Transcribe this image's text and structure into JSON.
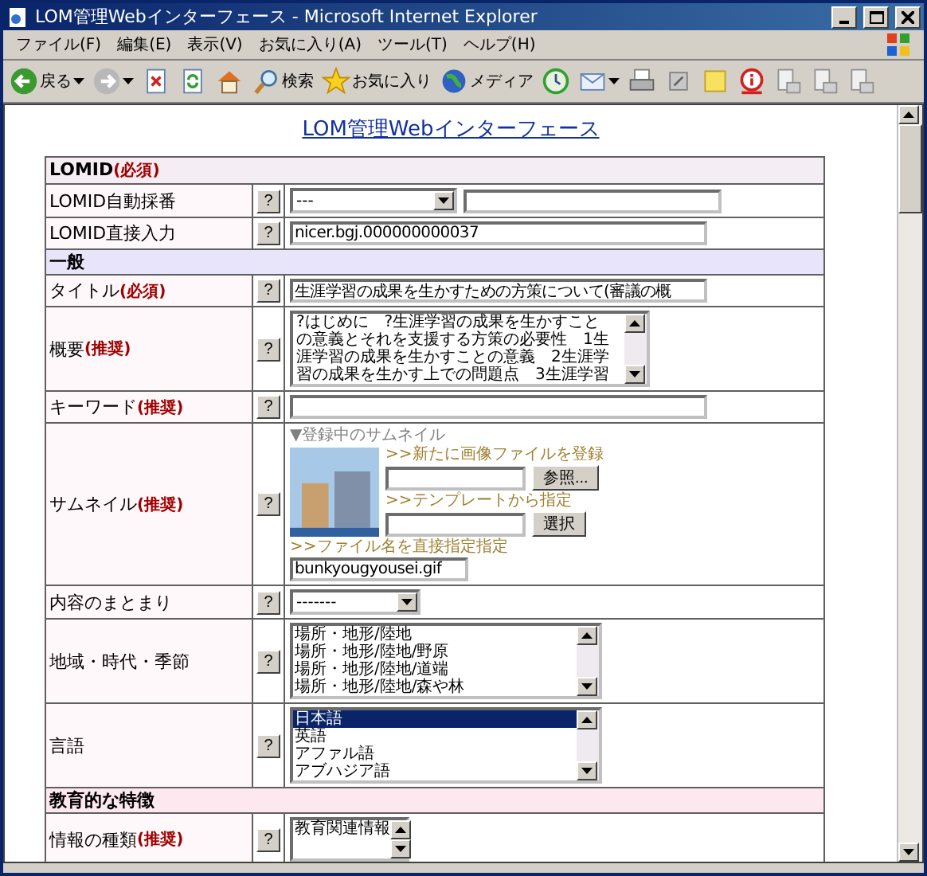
{
  "window": {
    "title": "LOM管理Webインターフェース - Microsoft Internet Explorer"
  },
  "menu": [
    "ファイル(F)",
    "編集(E)",
    "表示(V)",
    "お気に入り(A)",
    "ツール(T)",
    "ヘルプ(H)"
  ],
  "toolbar": [
    {
      "kind": "back",
      "label": "戻る"
    },
    {
      "kind": "forward"
    },
    {
      "kind": "stop"
    },
    {
      "kind": "refresh"
    },
    {
      "kind": "home"
    },
    {
      "kind": "search",
      "label": "検索"
    },
    {
      "kind": "favorites",
      "label": "お気に入り"
    },
    {
      "kind": "media",
      "label": "メディア"
    },
    {
      "kind": "history"
    },
    {
      "kind": "mail"
    },
    {
      "kind": "print"
    },
    {
      "kind": "edit"
    },
    {
      "kind": "note"
    },
    {
      "kind": "info"
    },
    {
      "kind": "doc"
    },
    {
      "kind": "doc"
    },
    {
      "kind": "doc"
    }
  ],
  "page_title": "LOM管理Webインターフェース",
  "form": [
    {
      "kind": "section",
      "label": "LOMID",
      "tag": "(必須)",
      "color": "#f4eef4"
    },
    {
      "kind": "select_text",
      "label": "LOMID自動採番",
      "help": "?",
      "value": "---"
    },
    {
      "kind": "text",
      "label": "LOMID直接入力",
      "help": "?",
      "value": "nicer.bgj.000000000037"
    },
    {
      "kind": "section",
      "label": "一般",
      "color": "#e8e4fa"
    },
    {
      "kind": "text",
      "label": "タイトル",
      "tag": "(必須)",
      "help": "?",
      "value": "生涯学習の成果を生かすための方策について(審議の概"
    },
    {
      "kind": "textarea",
      "label": "概要",
      "tag": "(推奨)",
      "help": "?",
      "lines": [
        "?はじめに　?生涯学習の成果を生かすこと",
        "の意義とそれを支援する方策の必要性　1生",
        "涯学習の成果を生かすことの意義　2生涯学",
        "習の成果を生かす上での問題点　3生涯学習"
      ]
    },
    {
      "kind": "text",
      "label": "キーワード",
      "tag": "(推奨)",
      "help": "?"
    },
    {
      "kind": "thumbnail",
      "label": "サムネイル",
      "tag": "(推奨)",
      "help": "?",
      "caption": "▼登録中のサムネイル",
      "upload_link": ">>新たに画像ファイルを登録",
      "browse": "参照...",
      "template_link": ">>テンプレートから指定",
      "choose": "選択",
      "file_link": ">>ファイル名を直接指定指定",
      "file": "bunkyougyousei.gif"
    },
    {
      "kind": "select",
      "label": "内容のまとまり",
      "help": "?",
      "value": "-------"
    },
    {
      "kind": "listbox",
      "label": "地域・時代・季節",
      "help": "?",
      "items": [
        {
          "text": "場所・地形/陸地",
          "selected": false
        },
        {
          "text": "場所・地形/陸地/野原",
          "selected": false
        },
        {
          "text": "場所・地形/陸地/道端",
          "selected": false
        },
        {
          "text": "場所・地形/陸地/森や林",
          "selected": false
        }
      ]
    },
    {
      "kind": "listbox",
      "label": "言語",
      "help": "?",
      "items": [
        {
          "text": "日本語",
          "selected": true
        },
        {
          "text": "英語",
          "selected": false
        },
        {
          "text": "アファル語",
          "selected": false
        },
        {
          "text": "アブハジア語",
          "selected": false
        }
      ]
    },
    {
      "kind": "section",
      "label": "教育的な特徴",
      "color": "#fce8ee"
    },
    {
      "kind": "listbox",
      "label": "情報の種類",
      "tag": "(推奨)",
      "help": "?",
      "items": [
        {
          "text": "教育関連情報",
          "selected": false
        }
      ]
    }
  ]
}
